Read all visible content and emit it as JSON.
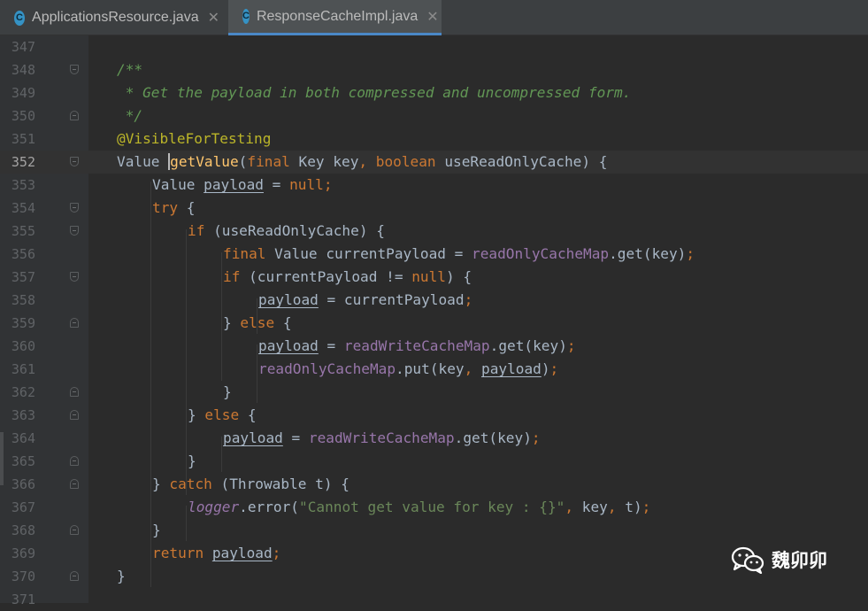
{
  "tabs": [
    {
      "label": "ApplicationsResource.java",
      "icon": "C",
      "active": false
    },
    {
      "label": "ResponseCacheImpl.java",
      "icon": "C",
      "active": true
    }
  ],
  "close_glyph": "✕",
  "line_numbers": [
    "347",
    "348",
    "349",
    "350",
    "351",
    "352",
    "353",
    "354",
    "355",
    "356",
    "357",
    "358",
    "359",
    "360",
    "361",
    "362",
    "363",
    "364",
    "365",
    "366",
    "367",
    "368",
    "369",
    "370",
    "371"
  ],
  "code": {
    "doc_open": "/**",
    "doc_text": " * Get the payload in both compressed and uncompressed form.",
    "doc_close": " */",
    "annotation": "@VisibleForTesting",
    "type_value": "Value",
    "method_name": "getValue",
    "kw_final": "final",
    "type_key": "Key",
    "param_key": "key",
    "kw_boolean": "boolean",
    "param_flag": "useReadOnlyCache",
    "var_payload": "payload",
    "kw_null": "null",
    "kw_try": "try",
    "kw_if": "if",
    "kw_else": "else",
    "var_current": "currentPayload",
    "field_readonly": "readOnlyCacheMap",
    "field_readwrite": "readWriteCacheMap",
    "method_get": "get",
    "method_put": "put",
    "kw_catch": "catch",
    "type_throwable": "Throwable",
    "param_t": "t",
    "field_logger": "logger",
    "method_error": "error",
    "error_message": "\"Cannot get value for key : {}\"",
    "kw_return": "return"
  },
  "watermark": "魏卯卯",
  "colors": {
    "editor_bg": "#2b2b2b",
    "gutter_bg": "#313335",
    "tab_accent": "#4a88c7",
    "keyword": "#cc7832",
    "comment": "#629755",
    "annotation": "#bbb529",
    "method": "#ffc66d",
    "field": "#9876aa",
    "string": "#6a8759",
    "text": "#a9b7c6"
  }
}
